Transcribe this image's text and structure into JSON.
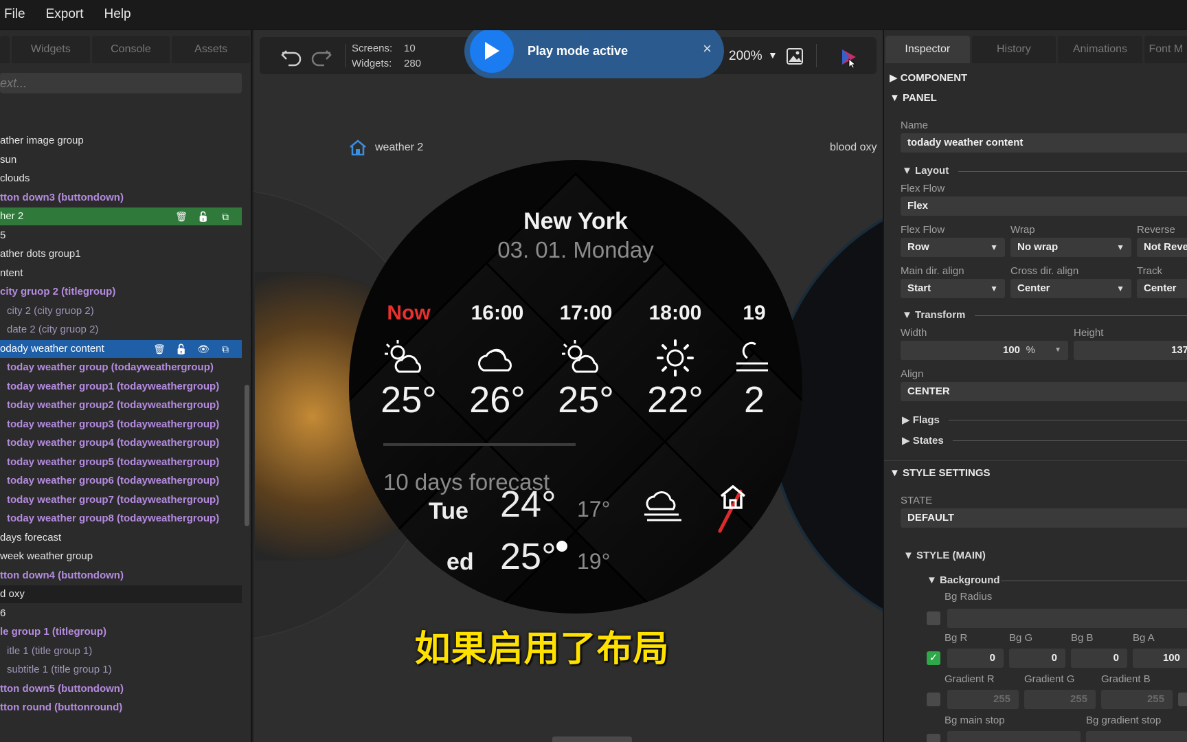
{
  "menubar": {
    "items": [
      "File",
      "Export",
      "Help"
    ]
  },
  "left_panel": {
    "tabs": [
      "Widgets",
      "Console",
      "Assets"
    ],
    "search_placeholder": "ext...",
    "tree": [
      {
        "label": "ather image group",
        "style": "normal"
      },
      {
        "label": "sun",
        "style": "normal"
      },
      {
        "label": "clouds",
        "style": "normal"
      },
      {
        "label": "tton down3 (buttondown)",
        "style": "purple"
      },
      {
        "label": "her 2",
        "style": "green"
      },
      {
        "label": "5",
        "style": "normal"
      },
      {
        "label": "ather dots group1",
        "style": "normal"
      },
      {
        "label": "ntent",
        "style": "normal"
      },
      {
        "label": "city gruop 2 (titlegroup)",
        "style": "purple"
      },
      {
        "label": "city 2 (city gruop 2)",
        "style": "dim"
      },
      {
        "label": "date 2 (city gruop 2)",
        "style": "dim"
      },
      {
        "label": "odady weather content",
        "style": "blue"
      },
      {
        "label": "today weather group (todayweathergroup)",
        "style": "purple"
      },
      {
        "label": "today weather group1 (todayweathergroup)",
        "style": "purple"
      },
      {
        "label": "today weather group2 (todayweathergroup)",
        "style": "purple"
      },
      {
        "label": "today weather group3 (todayweathergroup)",
        "style": "purple"
      },
      {
        "label": "today weather group4 (todayweathergroup)",
        "style": "purple"
      },
      {
        "label": "today weather group5 (todayweathergroup)",
        "style": "purple"
      },
      {
        "label": "today weather group6 (todayweathergroup)",
        "style": "purple"
      },
      {
        "label": "today weather group7 (todayweathergroup)",
        "style": "purple"
      },
      {
        "label": "today weather group8 (todayweathergroup)",
        "style": "purple"
      },
      {
        "label": "days forecast",
        "style": "normal"
      },
      {
        "label": "week weather group",
        "style": "normal"
      },
      {
        "label": "tton down4 (buttondown)",
        "style": "purple"
      },
      {
        "label": "d oxy",
        "style": "dark"
      },
      {
        "label": "6",
        "style": "normal"
      },
      {
        "label": "le group 1 (titlegroup)",
        "style": "purple"
      },
      {
        "label": "itle 1 (title group 1)",
        "style": "dim"
      },
      {
        "label": "subtitle 1 (title group 1)",
        "style": "dim"
      },
      {
        "label": "tton down5 (buttondown)",
        "style": "purple"
      },
      {
        "label": "tton round (buttonround)",
        "style": "purple"
      }
    ]
  },
  "toolbar": {
    "screens_label": "Screens:",
    "screens_value": "10",
    "widgets_label": "Widgets:",
    "widgets_value": "280",
    "zoom": "200%"
  },
  "play_banner": {
    "text": "Play mode active",
    "close": "×"
  },
  "canvas": {
    "screen_title": "weather 2",
    "next_screen_title": "blood oxy"
  },
  "watch": {
    "city": "New York",
    "date": "03. 01. Monday",
    "hours": [
      {
        "label": "Now",
        "temp": "25°",
        "icon": "sun-cloud-icon",
        "now": true
      },
      {
        "label": "16:00",
        "temp": "26°",
        "icon": "cloud-icon",
        "now": false
      },
      {
        "label": "17:00",
        "temp": "25°",
        "icon": "sun-cloud-icon",
        "now": false
      },
      {
        "label": "18:00",
        "temp": "22°",
        "icon": "sun-icon",
        "now": false
      },
      {
        "label": "19",
        "temp": "2",
        "icon": "fog-icon",
        "now": false
      }
    ],
    "forecast_title": "10 days forecast",
    "forecast": [
      {
        "day": "Tue",
        "hi": "24°",
        "lo": "17°"
      },
      {
        "day": "ed",
        "hi": "25°",
        "lo": "19°"
      }
    ]
  },
  "subtitle_text": "如果启用了布局",
  "inspector": {
    "tabs": [
      "Inspector",
      "History",
      "Animations",
      "Font M"
    ],
    "sections": {
      "component": "COMPONENT",
      "panel": "PANEL",
      "style_settings": "STYLE SETTINGS"
    },
    "name_label": "Name",
    "name_value": "todady weather content",
    "layout_label": "Layout",
    "flex_flow_label": "Flex Flow",
    "flex_flow_value": "Flex",
    "flex_flow2_label": "Flex Flow",
    "flex_flow2_value": "Row",
    "wrap_label": "Wrap",
    "wrap_value": "No wrap",
    "reverse_label": "Reverse",
    "reverse_value": "Not Reve",
    "main_align_label": "Main dir. align",
    "main_align_value": "Start",
    "cross_align_label": "Cross dir. align",
    "cross_align_value": "Center",
    "track_label": "Track",
    "track_value": "Center",
    "transform_label": "Transform",
    "width_label": "Width",
    "width_value": "100",
    "width_unit": "%",
    "height_label": "Height",
    "height_value": "137",
    "align_label": "Align",
    "align_value": "CENTER",
    "flags_label": "Flags",
    "states_label": "States",
    "state_label": "STATE",
    "state_value": "DEFAULT",
    "style_main_label": "STYLE (MAIN)",
    "background_label": "Background",
    "bg_radius_label": "Bg Radius",
    "bg_r_label": "Bg R",
    "bg_r_value": "0",
    "bg_g_label": "Bg G",
    "bg_g_value": "0",
    "bg_b_label": "Bg B",
    "bg_b_value": "0",
    "bg_a_label": "Bg A",
    "bg_a_value": "100",
    "grad_r_label": "Gradient R",
    "grad_r_value": "255",
    "grad_g_label": "Gradient G",
    "grad_g_value": "255",
    "grad_b_label": "Gradient B",
    "grad_b_value": "255",
    "bg_main_stop_label": "Bg main stop",
    "bg_grad_stop_label": "Bg gradient stop"
  },
  "colors": {
    "accent_blue": "#1e5fa8",
    "selected_green": "#2f7a3a",
    "tree_purple": "#b58be0",
    "now_red": "#e8302f",
    "subtitle_yellow": "#ffe100"
  }
}
